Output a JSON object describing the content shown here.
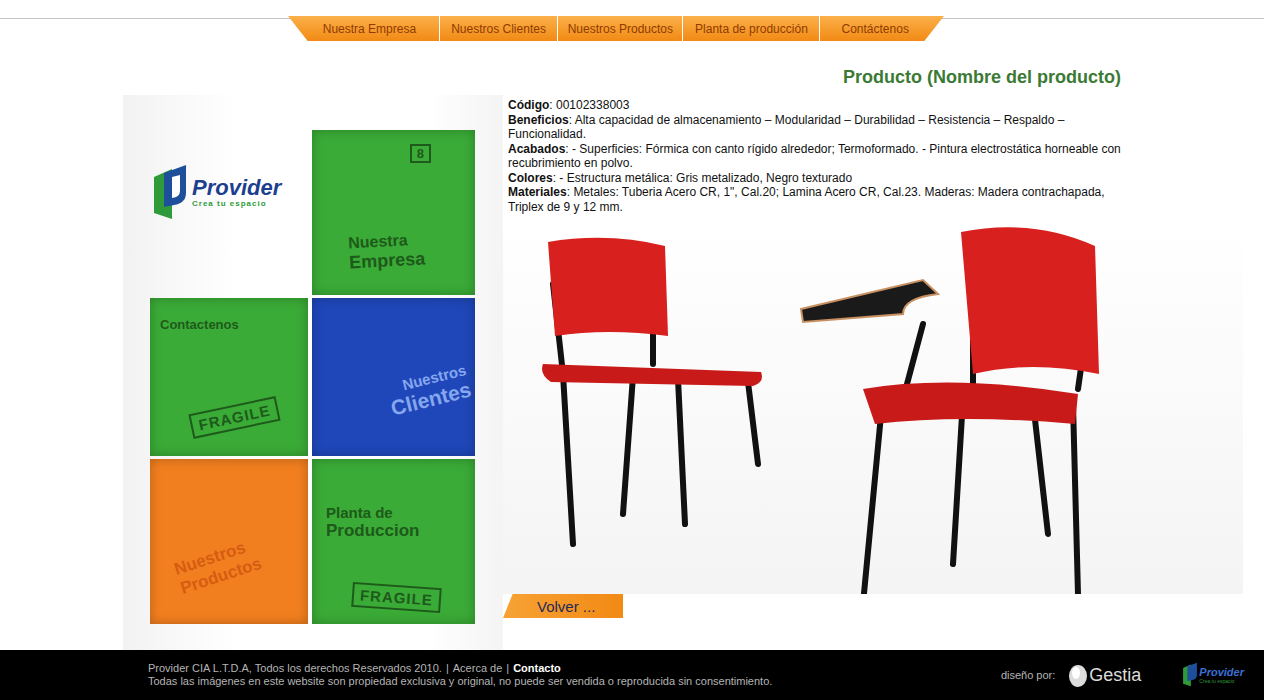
{
  "nav": [
    {
      "label": "Nuestra Empresa"
    },
    {
      "label": "Nuestros Clientes"
    },
    {
      "label": "Nuestros Productos"
    },
    {
      "label": "Planta de producción"
    },
    {
      "label": "Contáctenos"
    }
  ],
  "logo": {
    "name": "Provider",
    "tagline": "Crea tu espacio"
  },
  "boxes": [
    {
      "lines": [
        "Nuestra",
        "Empresa"
      ],
      "color": "#3aab36",
      "ink": "#1e5a1b",
      "badge": "8",
      "stamp": ""
    },
    {
      "lines": [
        "Contactenos"
      ],
      "color": "#3aab36",
      "ink": "#1e5a1b",
      "badge": "",
      "stamp": "FRAGILE"
    },
    {
      "lines": [
        "Nuestros",
        "Clientes"
      ],
      "color": "#1f47b9",
      "ink": "#86a6ee",
      "badge": "",
      "stamp": ""
    },
    {
      "lines": [
        "Nuestros",
        "Productos"
      ],
      "color": "#f27f1f",
      "ink": "#d65c12",
      "badge": "",
      "stamp": ""
    },
    {
      "lines": [
        "Planta de",
        "Produccion"
      ],
      "color": "#3aab36",
      "ink": "#1e5a1b",
      "badge": "",
      "stamp": "FRAGILE"
    }
  ],
  "product": {
    "title": "Producto (Nombre del producto)",
    "specs": [
      {
        "label": "Código",
        "value": "00102338003"
      },
      {
        "label": "Beneficios",
        "value": "Alta capacidad de almacenamiento – Modularidad – Durabilidad – Resistencia –   Respaldo – Funcionalidad."
      },
      {
        "label": "Acabados",
        "value": "- Superficies: Fórmica con canto rígido alrededor; Termoformado. - Pintura electrostática horneable con recubrimiento en polvo."
      },
      {
        "label": "Colores",
        "value": "- Estructura metálica: Gris metalizado, Negro texturado"
      },
      {
        "label": "Materiales",
        "value": "Metales: Tuberia Acero CR, 1\", Cal.20; Lamina Acero CR, Cal.23. Maderas: Madera contrachapada, Triplex de 9 y 12 mm."
      }
    ]
  },
  "back_button": "Volver ...",
  "footer": {
    "copyright": "Provider CIA  L.T.D.A, Todos los derechos Reservados 2010.",
    "separator": "|",
    "links": [
      {
        "label": "Acerca de",
        "bold": false
      },
      {
        "label": "Contacto",
        "bold": true
      }
    ],
    "notice": "Todas las imágenes en este website son propiedad exclusiva y original, no puede ser vendida o reproducida sin consentimiento.",
    "designer_label": "diseño por:",
    "designer": "Gestia",
    "brand": "Provider",
    "brand_tagline": "Crea tu espacio"
  }
}
